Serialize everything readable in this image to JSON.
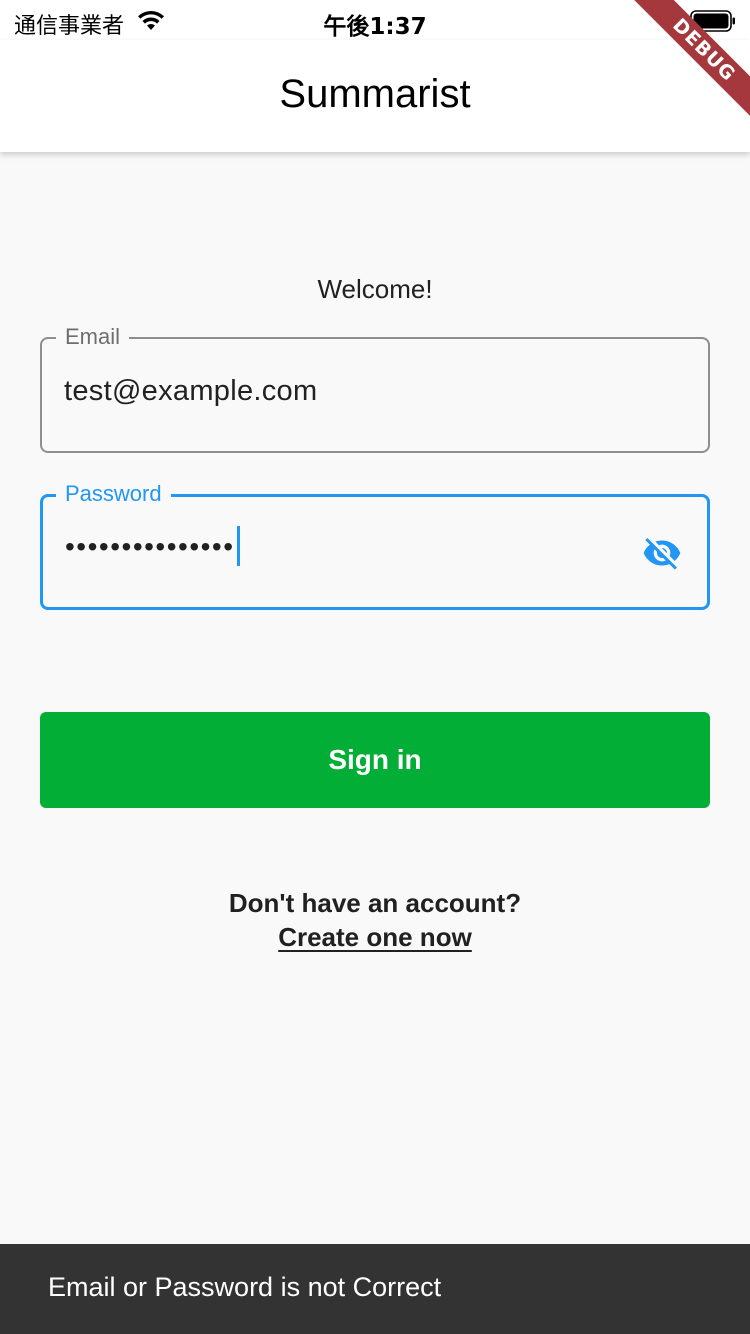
{
  "status_bar": {
    "carrier": "通信事業者",
    "time": "午後1:37",
    "wifi_icon": "wifi-icon",
    "battery_icon": "battery-icon"
  },
  "debug_banner": "DEBUG",
  "app_bar": {
    "title": "Summarist"
  },
  "form": {
    "welcome": "Welcome!",
    "email": {
      "label": "Email",
      "value": "test@example.com"
    },
    "password": {
      "label": "Password",
      "value": "•••••••••••••••",
      "visibility_icon": "eye-off-icon"
    },
    "sign_in_label": "Sign in",
    "no_account_text": "Don't have an account?",
    "create_link_label": "Create one now"
  },
  "snackbar": {
    "message": "Email or Password is not Correct"
  },
  "colors": {
    "accent": "#2196f3",
    "button": "#02ae36",
    "snackbar": "#333333",
    "debug_banner": "#a4383c"
  }
}
